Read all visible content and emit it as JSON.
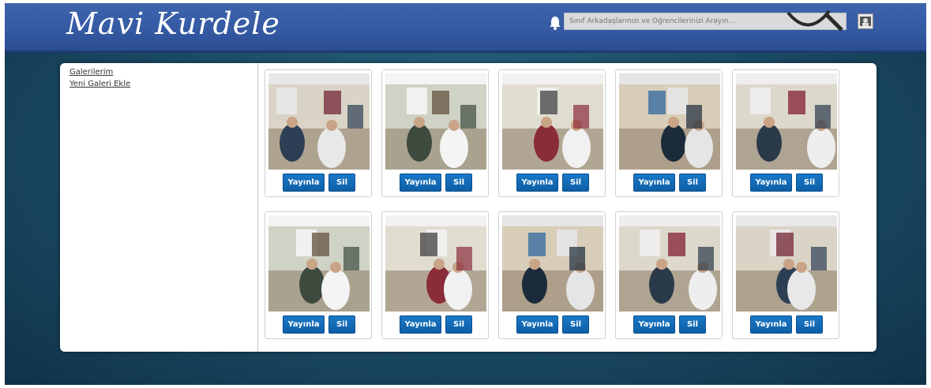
{
  "header": {
    "logo": "Mavi Kurdele",
    "search_placeholder": "Sınıf Arkadaşlarınızı ve Öğrencilerinizi Arayın...",
    "colors": {
      "bar": "#355aa3",
      "button": "#1a78c6"
    }
  },
  "sidebar": {
    "links": [
      "Galerilerim",
      "Yeni Galeri Ekle"
    ]
  },
  "gallery": {
    "publish_label": "Yayınla",
    "delete_label": "Sil",
    "photos": [
      {
        "id": 1
      },
      {
        "id": 2
      },
      {
        "id": 3
      },
      {
        "id": 4
      },
      {
        "id": 5
      },
      {
        "id": 6
      },
      {
        "id": 7
      },
      {
        "id": 8
      },
      {
        "id": 9
      },
      {
        "id": 10
      }
    ]
  }
}
